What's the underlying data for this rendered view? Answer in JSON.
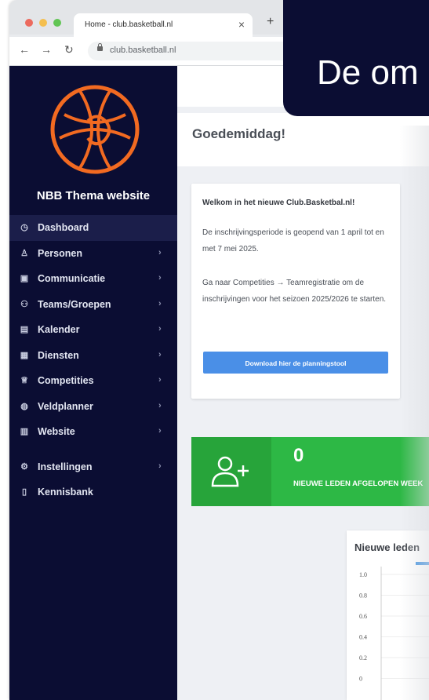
{
  "browser": {
    "tab_title": "Home - club.basketball.nl",
    "tab_close": "×",
    "new_tab": "+",
    "back": "←",
    "forward": "→",
    "reload": "↻",
    "url": "club.basketball.nl"
  },
  "sidebar": {
    "site_title": "NBB Thema website",
    "logo_color": "#f26a21",
    "items": [
      {
        "label": "Dashboard",
        "icon": "dashboard-icon",
        "glyph": "◷",
        "chevron": false,
        "active": true
      },
      {
        "label": "Personen",
        "icon": "people-icon",
        "glyph": "♙",
        "chevron": true,
        "active": false
      },
      {
        "label": "Communicatie",
        "icon": "message-icon",
        "glyph": "▣",
        "chevron": true,
        "active": false
      },
      {
        "label": "Teams/Groepen",
        "icon": "teams-icon",
        "glyph": "⚇",
        "chevron": true,
        "active": false
      },
      {
        "label": "Kalender",
        "icon": "calendar-icon",
        "glyph": "▤",
        "chevron": true,
        "active": false
      },
      {
        "label": "Diensten",
        "icon": "clipboard-icon",
        "glyph": "▦",
        "chevron": true,
        "active": false
      },
      {
        "label": "Competities",
        "icon": "trophy-icon",
        "glyph": "♕",
        "chevron": true,
        "active": false
      },
      {
        "label": "Veldplanner",
        "icon": "basketball-icon",
        "glyph": "◍",
        "chevron": true,
        "active": false
      },
      {
        "label": "Website",
        "icon": "website-icon",
        "glyph": "▥",
        "chevron": true,
        "active": false
      },
      {
        "label": "Instellingen",
        "icon": "settings-icon",
        "glyph": "⚙",
        "chevron": true,
        "active": false
      },
      {
        "label": "Kennisbank",
        "icon": "book-icon",
        "glyph": "▯",
        "chevron": false,
        "active": false
      }
    ],
    "chevron": "›"
  },
  "main": {
    "greeting": "Goedemiddag!",
    "welcome": {
      "title": "Welkom in het nieuwe Club.Basketbal.nl!",
      "p1": "De inschrijvingsperiode is geopend van 1 april tot en met 7 mei 2025.",
      "p2": "Ga naar Competities → Teamregistratie om de inschrijvingen voor het seizoen 2025/2026 te starten.",
      "button": "Download hier de planningstool",
      "button_color": "#4a8fe7"
    },
    "stat": {
      "value": "0",
      "label": "NIEUWE LEDEN AFGELOPEN WEEK",
      "color": "#2db845"
    },
    "chart_title": "Nieuwe leden"
  },
  "chart_data": {
    "type": "bar",
    "title": "Nieuwe leden",
    "y_ticks": [
      "1.0",
      "0.8",
      "0.6",
      "0.4",
      "0.2",
      "0"
    ],
    "ylim": [
      0,
      1.0
    ],
    "bar_color": "#3b8fe0"
  },
  "banner": {
    "text": "De om"
  }
}
